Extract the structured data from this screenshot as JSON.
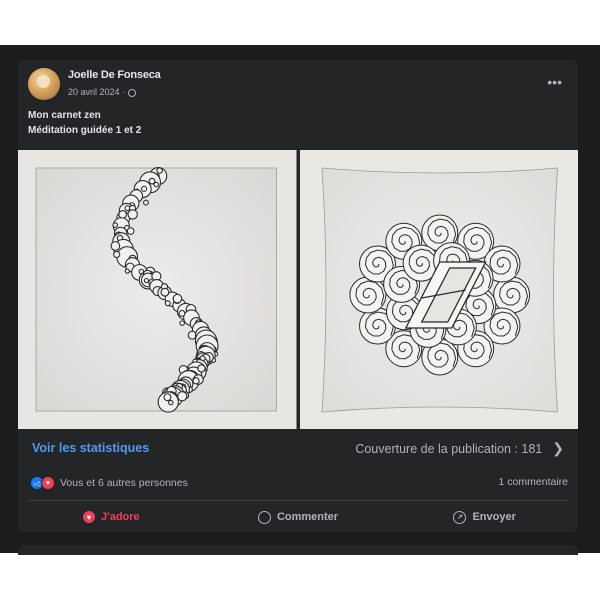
{
  "post": {
    "author": "Joelle De Fonseca",
    "date": "20 avril 2024 · ",
    "privacy_icon": "globe-icon",
    "more_label": "•••",
    "text_line1": "Mon carnet zen",
    "text_line2": "Méditation guidée 1 et 2"
  },
  "footer": {
    "stats_link": "Voir les statistiques",
    "coverage": "Couverture de la publication : 181",
    "reactions_text": "Vous et 6 autres personnes",
    "comments_count": "1 commentaire"
  },
  "actions": {
    "adore": "J'adore",
    "comment": "Commenter",
    "share": "Envoyer"
  },
  "colors": {
    "background": "#242526",
    "accent_blue": "#4b9cf6",
    "love_red": "#f33e58"
  }
}
